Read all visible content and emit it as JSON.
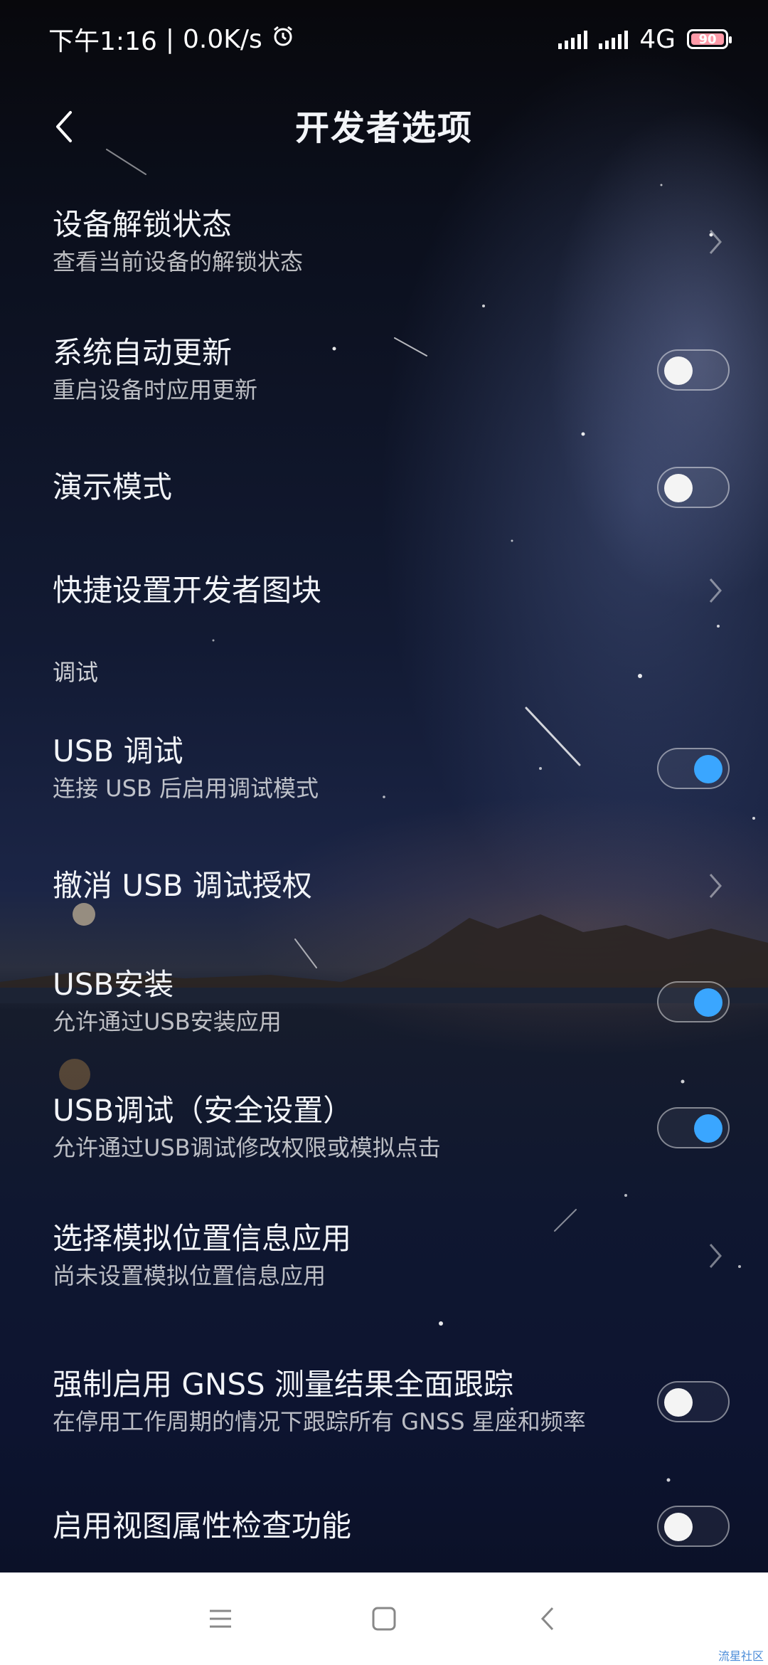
{
  "status_bar": {
    "time": "下午1:16",
    "separator": "|",
    "speed": "0.0K/s",
    "network": "4G",
    "battery": "90"
  },
  "header": {
    "title": "开发者选项"
  },
  "items": [
    {
      "title": "设备解锁状态",
      "subtitle": "查看当前设备的解锁状态",
      "control": "chevron"
    },
    {
      "title": "系统自动更新",
      "subtitle": "重启设备时应用更新",
      "control": "toggle",
      "state": "off"
    },
    {
      "title": "演示模式",
      "control": "toggle",
      "state": "off"
    },
    {
      "title": "快捷设置开发者图块",
      "control": "chevron"
    }
  ],
  "section_debug": "调试",
  "debug_items": [
    {
      "title": "USB 调试",
      "subtitle": "连接 USB 后启用调试模式",
      "control": "toggle",
      "state": "on"
    },
    {
      "title": "撤消 USB 调试授权",
      "control": "chevron"
    },
    {
      "title": "USB安装",
      "subtitle": "允许通过USB安装应用",
      "control": "toggle",
      "state": "on"
    },
    {
      "title": "USB调试（安全设置）",
      "subtitle": "允许通过USB调试修改权限或模拟点击",
      "control": "toggle",
      "state": "on"
    },
    {
      "title": "选择模拟位置信息应用",
      "subtitle": "尚未设置模拟位置信息应用",
      "control": "chevron"
    },
    {
      "title": "强制启用 GNSS 测量结果全面跟踪",
      "subtitle": "在停用工作周期的情况下跟踪所有 GNSS 星座和频率",
      "control": "toggle",
      "state": "off"
    },
    {
      "title": "启用视图属性检查功能",
      "control": "toggle",
      "state": "off"
    }
  ],
  "colors": {
    "toggle_on": "#3aa6ff",
    "nav_bg": "#ffffff"
  },
  "nav": {
    "icons": [
      "menu-icon",
      "home-square-icon",
      "back-icon"
    ]
  },
  "watermark": "流星社区"
}
